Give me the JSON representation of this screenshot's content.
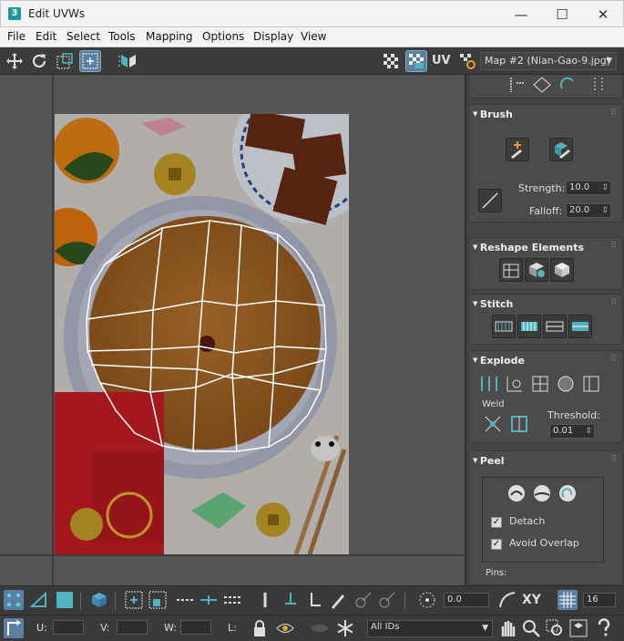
{
  "window": {
    "app_icon": "3",
    "title": "Edit UVWs",
    "minimize": "—",
    "maximize": "☐",
    "close": "✕"
  },
  "menu": [
    "File",
    "Edit",
    "Select",
    "Tools",
    "Mapping",
    "Options",
    "Display",
    "View"
  ],
  "toolbar": {
    "uv_label": "UV",
    "map_select": "Map #2 (Nian-Gao-9.jpg)",
    "map_arrow": "▼"
  },
  "brush": {
    "title": "Brush",
    "strength_label": "Strength:",
    "strength_value": "10.0",
    "falloff_label": "Falloff:",
    "falloff_value": "20.0"
  },
  "reshape": {
    "title": "Reshape Elements"
  },
  "stitch": {
    "title": "Stitch"
  },
  "explode": {
    "title": "Explode",
    "weld_label": "Weld",
    "threshold_label": "Threshold:",
    "threshold_value": "0.01"
  },
  "peel": {
    "title": "Peel",
    "detach_label": "Detach",
    "detach_checked": true,
    "avoid_overlap_label": "Avoid Overlap",
    "avoid_overlap_checked": true,
    "pins_label": "Pins:"
  },
  "bottom": {
    "rotate_value": "0.0",
    "xy_label": "XY",
    "grid_value": "16",
    "u_label": "U:",
    "v_label": "V:",
    "w_label": "W:",
    "l_label": "L:",
    "ids_select": "All IDs"
  },
  "colors": {
    "accent": "#4fb3c0",
    "panel": "#454545",
    "viewport": "#555555",
    "mesh": "#ffffff"
  },
  "grip": "⠿"
}
